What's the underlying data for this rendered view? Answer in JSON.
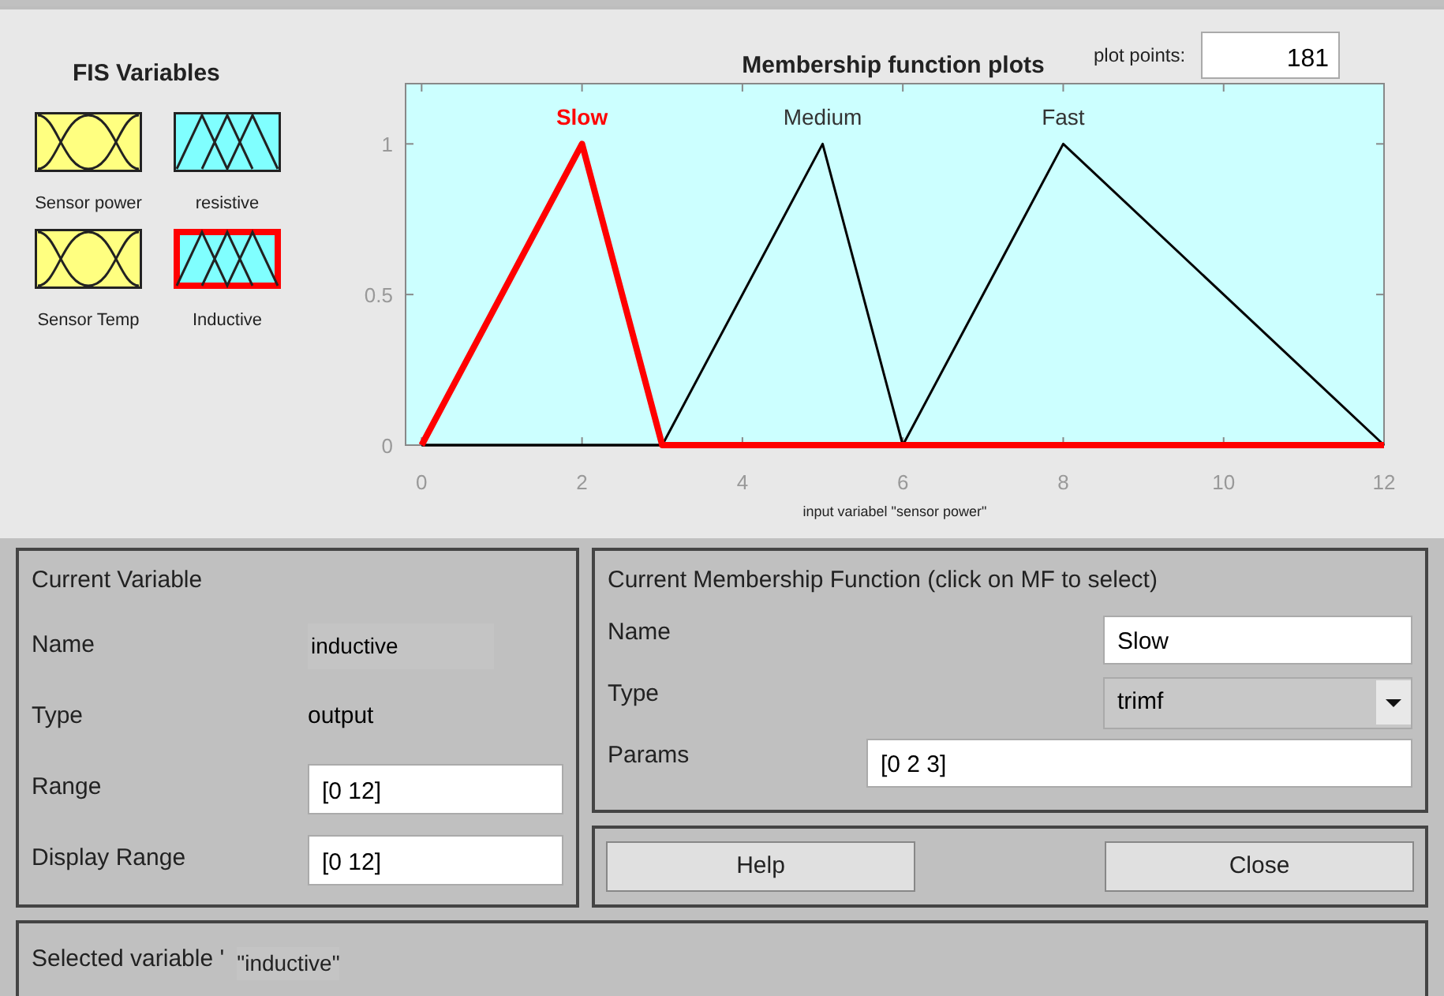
{
  "fis_variables": {
    "title": "FIS Variables",
    "items": [
      {
        "label": "Sensor power",
        "kind": "input",
        "selected": false
      },
      {
        "label": "resistive",
        "kind": "output",
        "selected": false
      },
      {
        "label": "Sensor Temp",
        "kind": "input",
        "selected": false
      },
      {
        "label": "Inductive",
        "kind": "output",
        "selected": true
      }
    ]
  },
  "plot": {
    "plot_points_label": "plot points:",
    "plot_points": "181",
    "chart_data": {
      "type": "line",
      "title": "Membership function plots",
      "xlabel": "input variabel \"sensor power\"",
      "x": [
        0,
        2,
        3,
        5,
        6,
        8,
        12
      ],
      "series": [
        {
          "name": "Slow",
          "color": "#ff0000",
          "values": [
            0,
            1,
            0,
            0,
            0,
            0,
            0
          ]
        },
        {
          "name": "Medium",
          "color": "#000000",
          "values": [
            0,
            0,
            0,
            1,
            0,
            0,
            0
          ]
        },
        {
          "name": "Fast",
          "color": "#000000",
          "values": [
            0,
            0,
            0,
            0,
            0,
            1,
            0
          ]
        }
      ],
      "xlim": [
        -0.2,
        12
      ],
      "ylim": [
        0,
        1.2
      ],
      "xticks": [
        0,
        2,
        4,
        6,
        8,
        10,
        12
      ],
      "yticks": [
        0,
        0.5,
        1
      ]
    }
  },
  "current_variable": {
    "title": "Current Variable",
    "rows": [
      {
        "label": "Name",
        "value": "inductive",
        "kind": "text"
      },
      {
        "label": "Type",
        "value": "output",
        "kind": "plain"
      },
      {
        "label": "Range",
        "value": "[0 12]",
        "kind": "field"
      },
      {
        "label": "Display Range",
        "value": "[0 12]",
        "kind": "field"
      }
    ]
  },
  "current_mf": {
    "title": "Current Membership Function (click on MF to select)",
    "rows": [
      {
        "label": "Name",
        "value": "Slow",
        "kind": "field"
      },
      {
        "label": "Type",
        "value": "trimf",
        "kind": "dropdown"
      },
      {
        "label": "Params",
        "value": "[0 2 3]",
        "kind": "wide_field"
      }
    ]
  },
  "buttons": [
    "Help",
    "Close"
  ],
  "status": {
    "label": "Selected variable '",
    "value": "\"inductive\""
  }
}
